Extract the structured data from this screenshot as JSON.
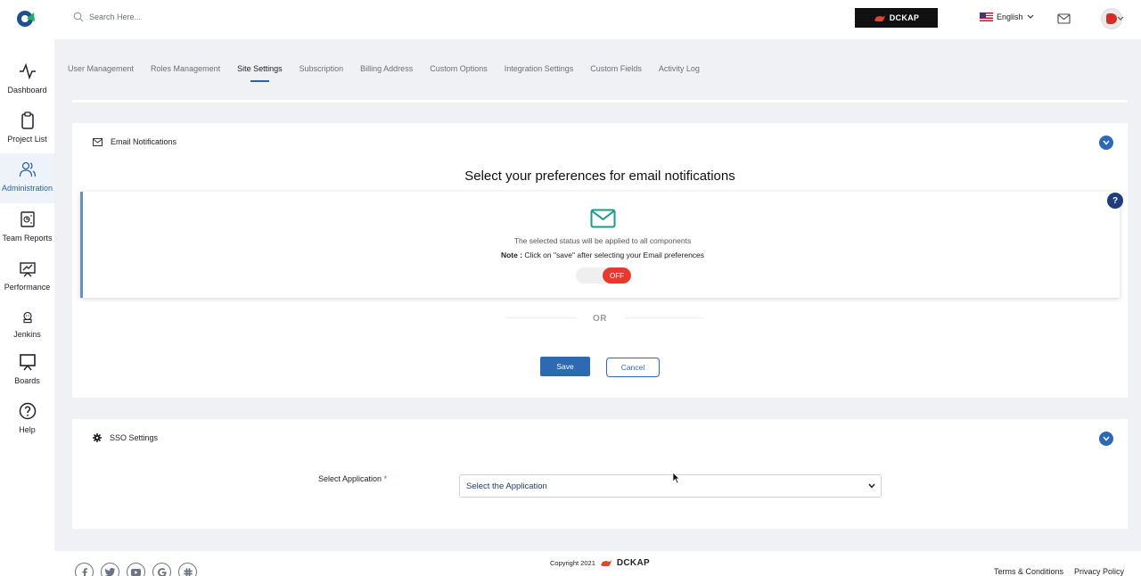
{
  "header": {
    "search_placeholder": "Search Here...",
    "brand_name": "DCKAP",
    "language": "English"
  },
  "sidebar": {
    "items": [
      {
        "label": "Dashboard",
        "icon": "activity-icon"
      },
      {
        "label": "Project List",
        "icon": "clipboard-icon"
      },
      {
        "label": "Administration",
        "icon": "users-icon",
        "active": true
      },
      {
        "label": "Team Reports",
        "icon": "report-icon"
      },
      {
        "label": "Performance",
        "icon": "performance-icon"
      },
      {
        "label": "Jenkins",
        "icon": "jenkins-icon"
      },
      {
        "label": "Boards",
        "icon": "board-icon"
      },
      {
        "label": "Help",
        "icon": "help-circle-icon"
      }
    ]
  },
  "tabs": [
    {
      "label": "User Management"
    },
    {
      "label": "Roles Management"
    },
    {
      "label": "Site Settings",
      "active": true
    },
    {
      "label": "Subscription"
    },
    {
      "label": "Billing Address"
    },
    {
      "label": "Custom Options"
    },
    {
      "label": "Integration Settings"
    },
    {
      "label": "Custom Fields"
    },
    {
      "label": "Activity Log"
    }
  ],
  "email_section": {
    "heading": "Email Notifications",
    "title": "Select your preferences for email notifications",
    "help_label": "?",
    "status_text": "The selected status will be applied to all components",
    "note_label": "Note :",
    "note_text": " Click on \"save\" after selecting your Email preferences",
    "toggle_label": "OFF",
    "or_text": "OR",
    "save_label": "Save",
    "cancel_label": "Cancel"
  },
  "sso_section": {
    "heading": "SSO Settings",
    "field_label": "Select Application",
    "required_mark": "*",
    "select_value": "Select the Application"
  },
  "footer": {
    "copyright": "Copyright 2021",
    "brand_name": "DCKAP",
    "links": [
      "Terms & Conditions",
      "Privacy Policy"
    ]
  },
  "colors": {
    "accent": "#2e69b3",
    "toggle_off": "#e8392e",
    "mail_icon": "#1a9b8a"
  }
}
